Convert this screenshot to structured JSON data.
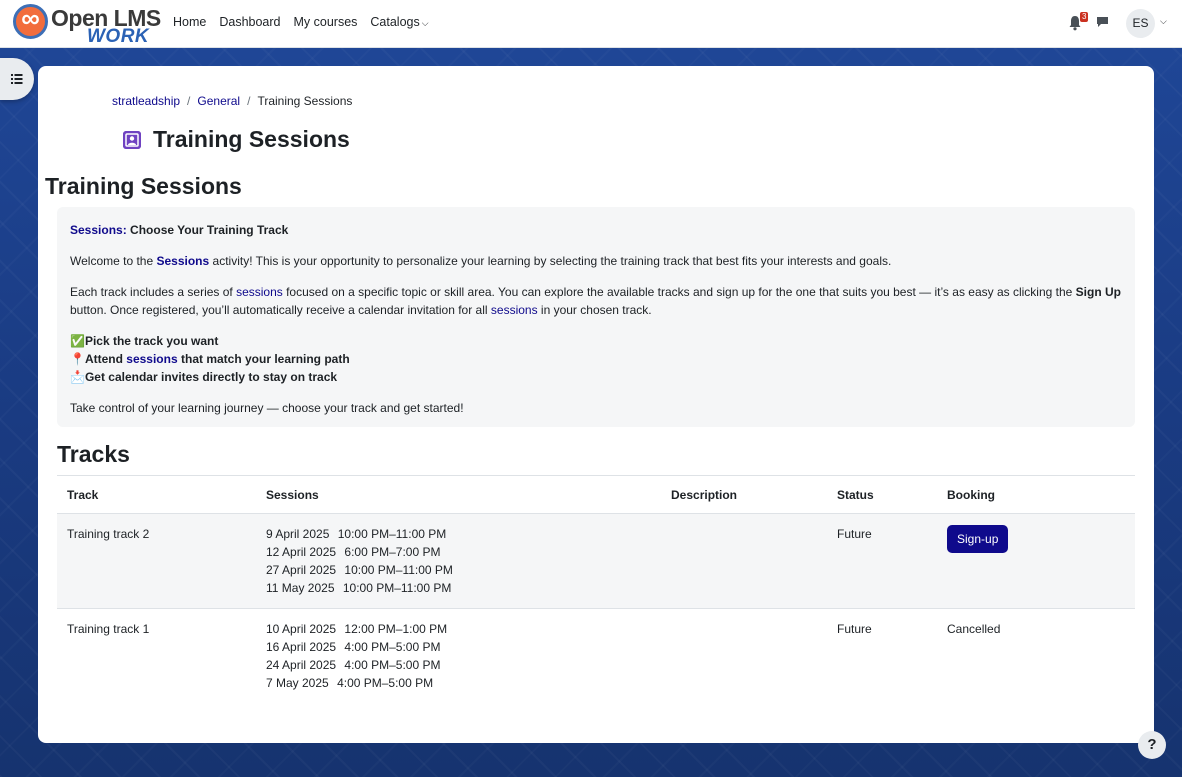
{
  "logo": {
    "line1": "Open LMS",
    "line2": "WORK"
  },
  "nav": {
    "home": "Home",
    "dashboard": "Dashboard",
    "my_courses": "My courses",
    "catalogs": "Catalogs"
  },
  "notifications": {
    "count": "3"
  },
  "user": {
    "initials": "ES"
  },
  "breadcrumb": {
    "course": "stratleadship",
    "section": "General",
    "current": "Training Sessions"
  },
  "page_title": "Training Sessions",
  "section_title": "Training Sessions",
  "intro": {
    "heading_link": "Sessions:",
    "heading_rest": " Choose Your Training Track",
    "p1_a": "Welcome to the ",
    "p1_link": "Sessions",
    "p1_b": " activity! This is your opportunity to personalize your learning by selecting the training track that best fits your interests and goals.",
    "p2_a": "Each track includes a series of ",
    "p2_link1": "sessions",
    "p2_b": " focused on a specific topic or skill area. You can explore the available tracks and sign up for the one that suits you best — it’s as easy as clicking the ",
    "p2_bold": "Sign Up",
    "p2_c": " button. Once registered, you’ll automatically receive a calendar invitation for all ",
    "p2_link2": "sessions",
    "p2_d": " in your chosen track.",
    "check1_icon": "✅",
    "check1": "Pick the track you want",
    "check2_icon": "📍",
    "check2_a": "Attend ",
    "check2_link": "sessions",
    "check2_b": " that match your learning path",
    "check3_icon": "📩",
    "check3": "Get calendar invites directly to stay on track",
    "closing": "Take control of your learning journey — choose your track and get started!"
  },
  "tracks_title": "Tracks",
  "table": {
    "headers": {
      "track": "Track",
      "sessions": "Sessions",
      "description": "Description",
      "status": "Status",
      "booking": "Booking"
    },
    "rows": [
      {
        "track": "Training track 2",
        "sessions": [
          {
            "date": "9 April 2025",
            "time": "10:00 PM–11:00 PM"
          },
          {
            "date": "12 April 2025",
            "time": "6:00 PM–7:00 PM"
          },
          {
            "date": "27 April 2025",
            "time": "10:00 PM–11:00 PM"
          },
          {
            "date": "11 May 2025",
            "time": "10:00 PM–11:00 PM"
          }
        ],
        "description": "",
        "status": "Future",
        "booking": "Sign-up"
      },
      {
        "track": "Training track 1",
        "sessions": [
          {
            "date": "10 April 2025",
            "time": "12:00 PM–1:00 PM"
          },
          {
            "date": "16 April 2025",
            "time": "4:00 PM–5:00 PM"
          },
          {
            "date": "24 April 2025",
            "time": "4:00 PM–5:00 PM"
          },
          {
            "date": "7 May 2025",
            "time": "4:00 PM–5:00 PM"
          }
        ],
        "description": "",
        "status": "Future",
        "booking": "Cancelled"
      }
    ]
  },
  "help": "?",
  "colors": {
    "accent": "#0f0a8c",
    "badge": "#ca3120",
    "activity_icon": "#6f42c1"
  }
}
